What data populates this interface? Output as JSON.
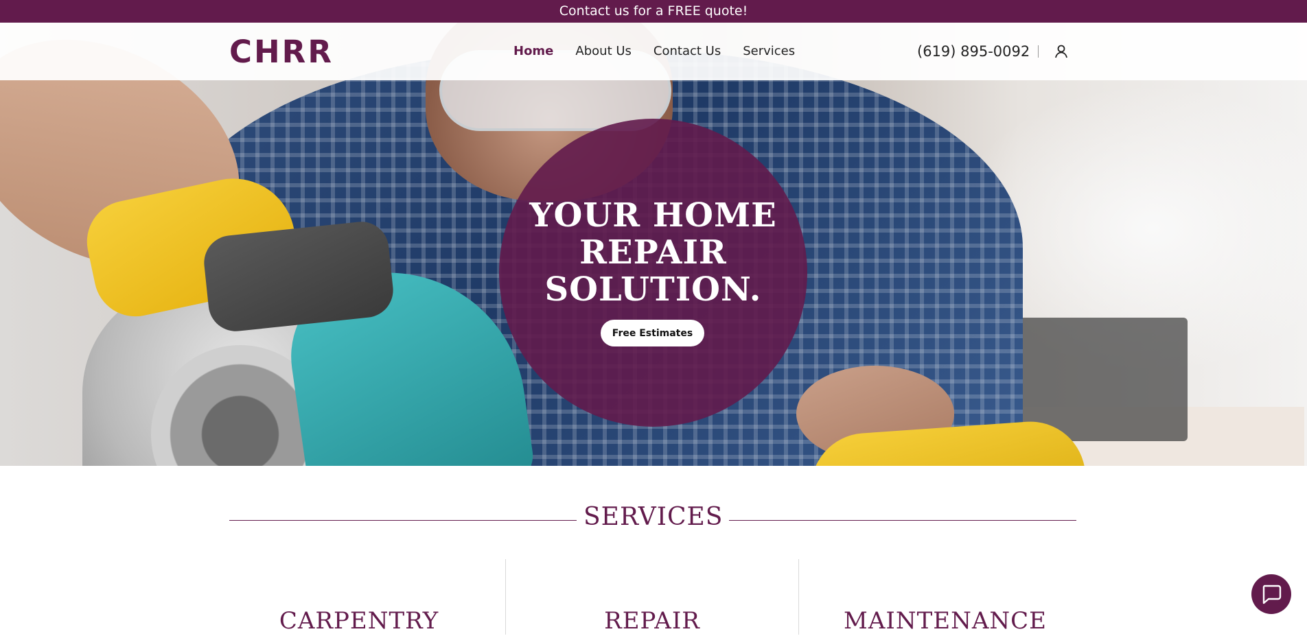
{
  "announcement": "Contact us for a FREE quote!",
  "brand": {
    "logo": "CHRR",
    "color": "#621b4c"
  },
  "nav": {
    "items": [
      {
        "label": "Home",
        "active": true
      },
      {
        "label": "About Us",
        "active": false
      },
      {
        "label": "Contact Us",
        "active": false
      },
      {
        "label": "Services",
        "active": false
      }
    ],
    "phone": "(619) 895-0092",
    "account_icon": "user-icon"
  },
  "hero": {
    "title_lines": [
      "YOUR HOME",
      "REPAIR",
      "SOLUTION."
    ],
    "cta_label": "Free Estimates"
  },
  "services": {
    "heading": "SERVICES",
    "items": [
      "CARPENTRY",
      "REPAIR",
      "MAINTENANCE"
    ]
  },
  "chat": {
    "icon": "chat-icon"
  }
}
